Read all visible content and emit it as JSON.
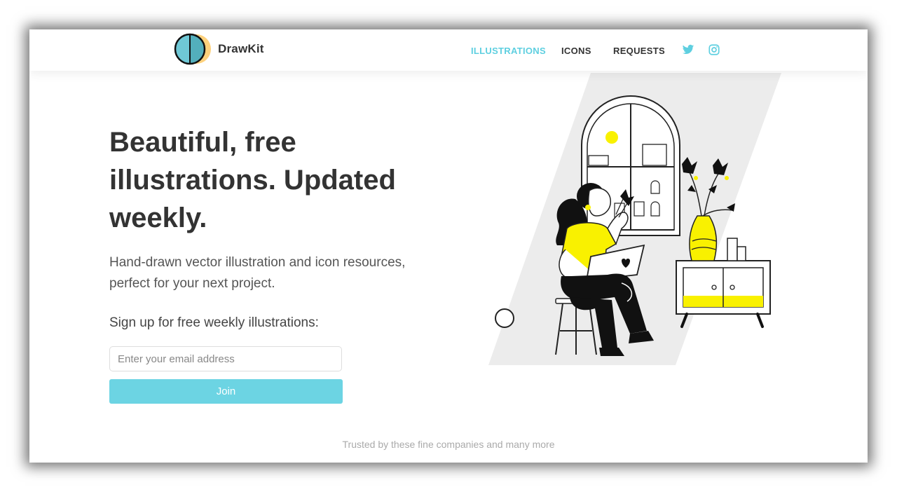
{
  "app": {
    "brand_name": "DrawKit"
  },
  "nav": {
    "items": [
      {
        "label": "ILLUSTRATIONS",
        "active": true
      },
      {
        "label": "ICONS",
        "active": false
      },
      {
        "label": "REQUESTS",
        "active": false
      }
    ],
    "social_icons": [
      "twitter-icon",
      "instagram-icon"
    ]
  },
  "hero": {
    "title": "Beautiful, free illustrations. Updated weekly.",
    "subtitle": "Hand-drawn vector illustration and icon resources, perfect for your next project.",
    "signup_label": "Sign up for free weekly illustrations:",
    "email_placeholder": "Enter your email address",
    "email_value": "",
    "join_label": "Join"
  },
  "footer": {
    "trusted_text": "Trusted by these fine companies and many more"
  },
  "colors": {
    "accent": "#5ecfe0",
    "button": "#6cd4e3",
    "text_dark": "#333333",
    "illustration_yellow": "#f9f100"
  }
}
